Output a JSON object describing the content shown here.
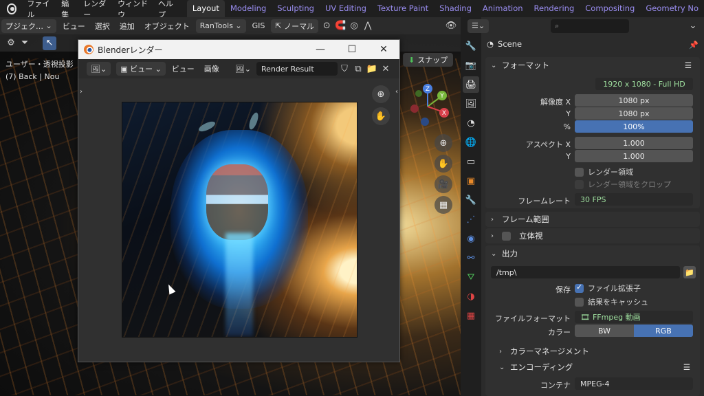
{
  "menu": [
    "ファイル",
    "編集",
    "レンダー",
    "ウィンドウ",
    "ヘルプ"
  ],
  "workspaces": [
    "Layout",
    "Modeling",
    "Sculpting",
    "UV Editing",
    "Texture Paint",
    "Shading",
    "Animation",
    "Rendering",
    "Compositing",
    "Geometry No"
  ],
  "active_workspace": "Layout",
  "viewport": {
    "header": {
      "mode_label": "プジェク…",
      "view": "ビュー",
      "select": "選択",
      "add": "追加",
      "object": "オブジェクト",
      "addon1": "RanTools",
      "addon2": "GIS",
      "orientation": "ノーマル"
    },
    "overlay_line1": "ユーザー・透視投影",
    "overlay_line2": "(7) Back | Nou",
    "snap_label": "スナップ",
    "gizmo_labels": {
      "z": "Z",
      "y": "Y",
      "x": "X"
    }
  },
  "render_window": {
    "title": "Blenderレンダー",
    "view_dropdown": "ビュー",
    "view_menu": "ビュー",
    "image_menu": "画像",
    "image_name": "Render Result"
  },
  "properties": {
    "search_placeholder": "",
    "scene_name": "Scene",
    "format": {
      "section": "フォーマット",
      "preset": "1920 x 1080 - Full HD",
      "res_x_label": "解像度 X",
      "res_x": "1080 px",
      "res_y_label": "Y",
      "res_y": "1080 px",
      "percent_label": "%",
      "percent": "100%",
      "aspect_x_label": "アスペクト X",
      "aspect_x": "1.000",
      "aspect_y_label": "Y",
      "aspect_y": "1.000",
      "render_region": "レンダー領域",
      "crop_region": "レンダー領域をクロップ",
      "framerate_label": "フレームレート",
      "framerate": "30 FPS"
    },
    "frame_range": "フレーム範囲",
    "stereoscopy": "立体視",
    "output": {
      "section": "出力",
      "path": "/tmp\\",
      "save_label": "保存",
      "file_extensions": "ファイル拡張子",
      "cache_result": "結果をキャッシュ",
      "file_format_label": "ファイルフォーマット",
      "file_format": "FFmpeg 動画",
      "color_label": "カラー",
      "color_bw": "BW",
      "color_rgb": "RGB",
      "color_management": "カラーマネージメント",
      "encoding": "エンコーディング",
      "container_label": "コンテナ",
      "container": "MPEG-4"
    }
  }
}
